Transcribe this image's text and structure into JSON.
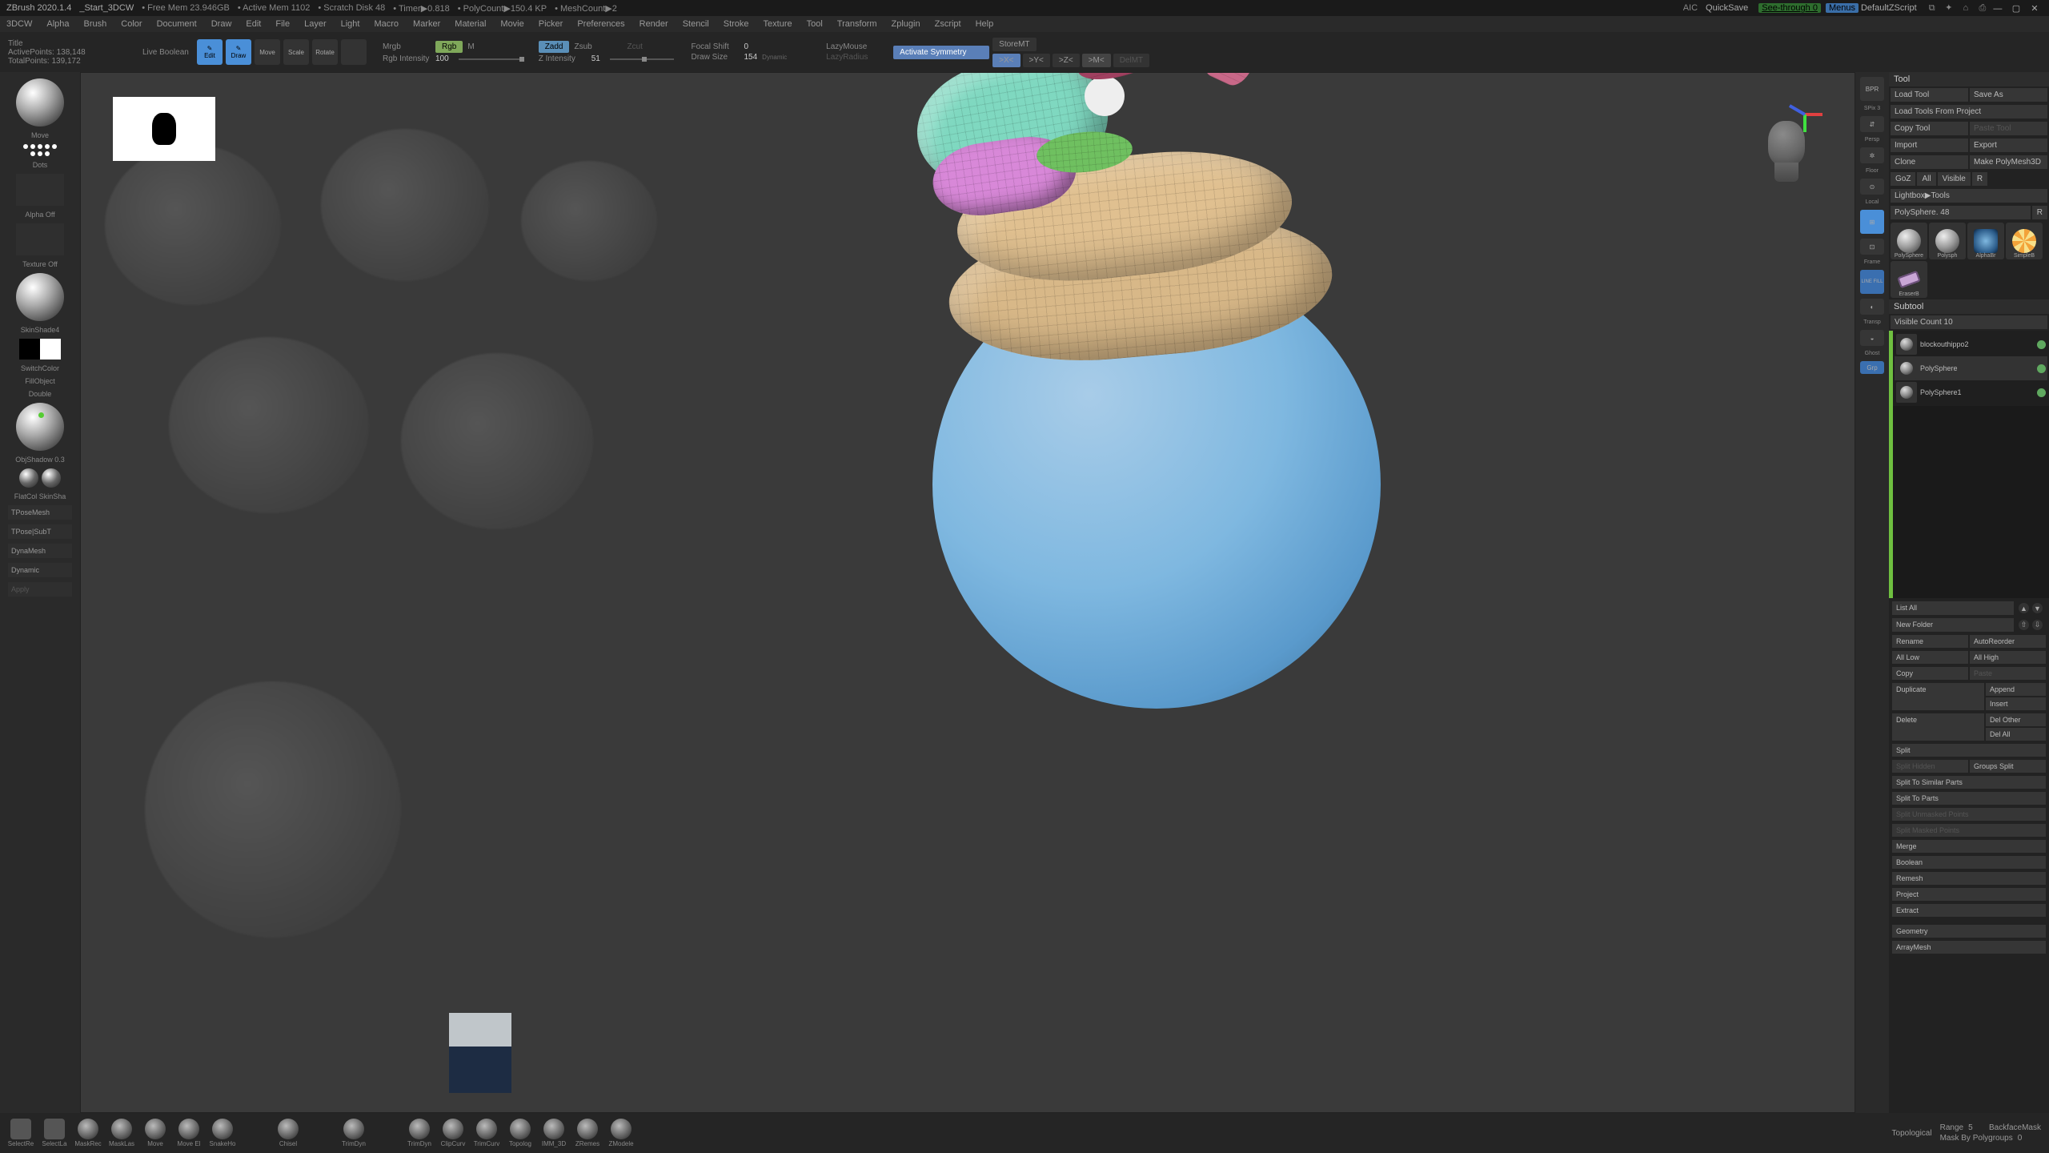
{
  "titlebar": {
    "app": "ZBrush 2020.1.4",
    "project": "_Start_3DCW",
    "freeMem": "Free Mem 23.946GB",
    "activeMem": "Active Mem 1102",
    "scratch": "Scratch Disk 48",
    "timer": "Timer▶0.818",
    "polyCount": "PolyCount▶150.4 KP",
    "meshCount": "MeshCount▶2",
    "aic": "AIC",
    "quickSave": "QuickSave",
    "seeThrough": "See-through  0",
    "menus": "Menus",
    "defaultZScript": "DefaultZScript"
  },
  "menubar": [
    "3DCW",
    "Alpha",
    "Brush",
    "Color",
    "Document",
    "Draw",
    "Edit",
    "File",
    "Layer",
    "Light",
    "Macro",
    "Marker",
    "Material",
    "Movie",
    "Picker",
    "Preferences",
    "Render",
    "Stencil",
    "Stroke",
    "Texture",
    "Tool",
    "Transform",
    "Zplugin",
    "Zscript",
    "Help"
  ],
  "shelf": {
    "title": "Title",
    "activePointsLabel": "ActivePoints:",
    "activePoints": "138,148",
    "totalPointsLabel": "TotalPoints:",
    "totalPoints": "139,172",
    "liveBoolean": "Live Boolean",
    "edit": "Edit",
    "draw": "Draw",
    "move": "Move",
    "scale": "Scale",
    "rotate": "Rotate",
    "mrgb": "Mrgb",
    "rgb": "Rgb",
    "m": "M",
    "rgbIntensityLabel": "Rgb Intensity",
    "rgbIntensity": "100",
    "zadd": "Zadd",
    "zsub": "Zsub",
    "zcut": "Zcut",
    "zIntensityLabel": "Z Intensity",
    "zIntensity": "51",
    "focalShiftLabel": "Focal Shift",
    "focalShift": "0",
    "drawSizeLabel": "Draw Size",
    "drawSize": "154",
    "dynamic": "Dynamic",
    "lazyMouse": "LazyMouse",
    "lazyRadius": "LazyRadius",
    "activateSymmetry": "Activate Symmetry",
    "x": ">X<",
    "y": ">Y<",
    "z": ">Z<",
    "m2": ">M<",
    "storeMT": "StoreMT",
    "delMT": "DelMT"
  },
  "left": {
    "move": "Move",
    "dots": "Dots",
    "alphaOff": "Alpha Off",
    "textureOff": "Texture Off",
    "skinShade": "SkinShade4",
    "switchColor": "SwitchColor",
    "fillObject": "FillObject",
    "double": "Double",
    "objShadow": "ObjShadow 0.3",
    "flatCol": "FlatCol SkinSha",
    "tpose": "TPoseMesh",
    "tposeSubT": "TPose|SubT",
    "dynamesh": "DynaMesh",
    "dynamic": "Dynamic",
    "apply": "Apply"
  },
  "vpRight": {
    "bpr": "BPR",
    "spix": "SPix 3",
    "persp": "Persp",
    "floor": "Floor",
    "local": "Local",
    "frame": "Frame",
    "linefill": "LINE FILL",
    "transp": "Transp",
    "ghost": "Ghost",
    "grp": "Grp"
  },
  "tool": {
    "header": "Tool",
    "loadTool": "Load Tool",
    "saveAs": "Save As",
    "loadProject": "Load Tools From Project",
    "copyTool": "Copy Tool",
    "pasteTool": "Paste Tool",
    "import": "Import",
    "export": "Export",
    "clone": "Clone",
    "makePolyMesh": "Make PolyMesh3D",
    "goZ": "GoZ",
    "all": "All",
    "visible": "Visible",
    "r": "R",
    "lightboxTools": "Lightbox▶Tools",
    "polySphereLabel": "PolySphere. 48",
    "thumbs": [
      "PolySphere",
      "Polysph",
      "AlphaBr",
      "SimpleB",
      "EraserB"
    ],
    "subtool": "Subtool",
    "visibleCountLabel": "Visible Count",
    "visibleCount": "10",
    "items": [
      {
        "name": "blockouthippo2"
      },
      {
        "name": "PolySphere"
      },
      {
        "name": "PolySphere1"
      }
    ],
    "listAll": "List All",
    "newFolder": "New Folder",
    "rename": "Rename",
    "autoReorder": "AutoReorder",
    "allLow": "All Low",
    "allHigh": "All High",
    "copy": "Copy",
    "paste": "Paste",
    "duplicate": "Duplicate",
    "append": "Append",
    "insert": "Insert",
    "delete": "Delete",
    "delOther": "Del Other",
    "delAll": "Del All",
    "split": "Split",
    "splitHidden": "Split Hidden",
    "groupsSplit": "Groups Split",
    "splitSimilar": "Split To Similar Parts",
    "splitParts": "Split To Parts",
    "splitUnmasked": "Split Unmasked Points",
    "splitMasked": "Split Masked Points",
    "merge": "Merge",
    "boolean": "Boolean",
    "remesh": "Remesh",
    "project": "Project",
    "extract": "Extract",
    "geometry": "Geometry",
    "arrayMesh": "ArrayMesh"
  },
  "bottom": {
    "brushes": [
      "SelectRe",
      "SelectLa",
      "MaskRec",
      "MaskLas",
      "Move",
      "Move El",
      "SnakeHo",
      "",
      "Chisel",
      "",
      "TrimDyn",
      "",
      "TrimDyn",
      "ClipCurv",
      "TrimCurv",
      "Topolog",
      "IMM_3D",
      "ZRemes",
      "ZModele"
    ],
    "topological": "Topological",
    "rangeLabel": "Range",
    "range": "5",
    "backfaceMask": "BackfaceMask",
    "maskByLabel": "Mask By Polygroups",
    "maskBy": "0"
  }
}
